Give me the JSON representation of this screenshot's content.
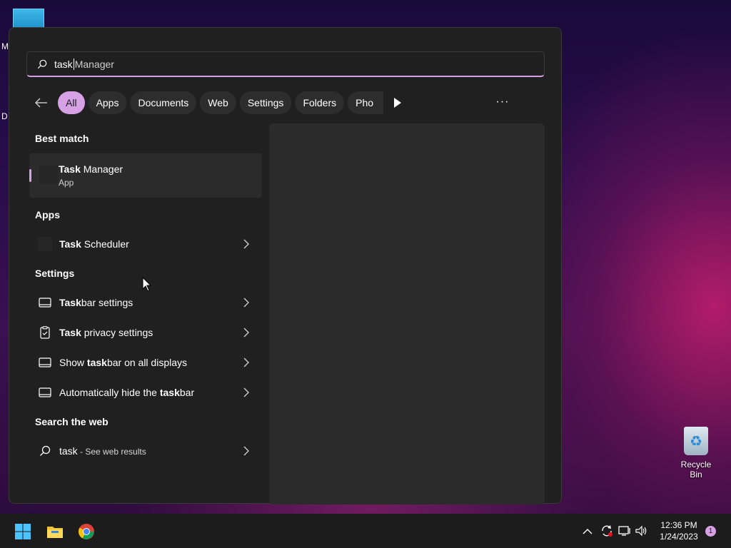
{
  "desktop": {
    "left_letters": [
      "M",
      "D"
    ],
    "recycle_bin_label": "Recycle Bin"
  },
  "search": {
    "typed_text": "task",
    "suggestion_text": "Manager"
  },
  "filters": {
    "chips": [
      "All",
      "Apps",
      "Documents",
      "Web",
      "Settings",
      "Folders",
      "Pho"
    ],
    "more_label": "···"
  },
  "sections": {
    "best_match": "Best match",
    "apps": "Apps",
    "settings": "Settings",
    "search_web": "Search the web"
  },
  "best_match_item": {
    "title_bold": "Task",
    "title_rest": " Manager",
    "subtitle": "App"
  },
  "apps_items": [
    {
      "bold": "Task",
      "rest": " Scheduler"
    }
  ],
  "settings_items": [
    {
      "pre": "",
      "bold": "Task",
      "rest": "bar settings",
      "icon": "taskbar-icon"
    },
    {
      "pre": "",
      "bold": "Task",
      "rest": " privacy settings",
      "icon": "clipboard-icon"
    },
    {
      "pre": "Show ",
      "bold": "task",
      "rest": "bar on all displays",
      "icon": "taskbar-icon"
    },
    {
      "pre": "Automatically hide the ",
      "bold": "task",
      "rest": "bar",
      "icon": "taskbar-icon"
    }
  ],
  "web_item": {
    "query": "task",
    "suffix": " - See web results"
  },
  "taskbar": {
    "time": "12:36 PM",
    "date": "1/24/2023",
    "notification_count": "1"
  },
  "colors": {
    "accent": "#d7a1e6",
    "panel_bg": "#202020",
    "taskbar_bg": "#1c1c1c"
  }
}
